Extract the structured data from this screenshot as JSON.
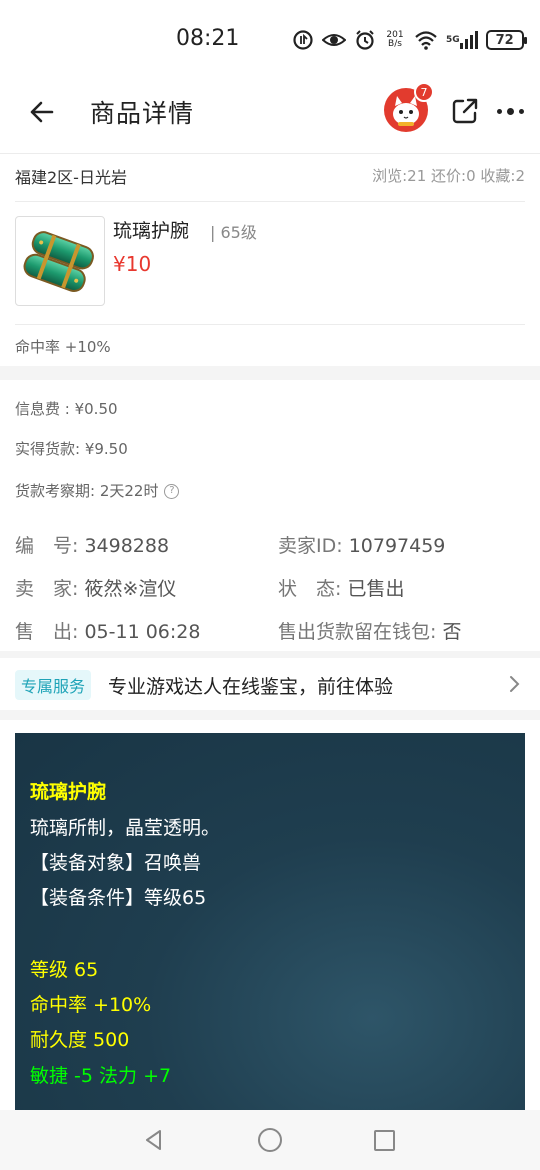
{
  "status_bar": {
    "time": "08:21",
    "net_speed_value": "201",
    "net_speed_unit": "B/s",
    "signal_label": "5G",
    "battery": "72",
    "icons": [
      "data-saver-icon",
      "eye-icon",
      "alarm-icon",
      "network-speed-icon",
      "wifi-icon",
      "signal-icon",
      "battery-icon"
    ]
  },
  "header": {
    "title": "商品详情",
    "avatar_badge": "7",
    "icons": [
      "back-arrow-icon",
      "avatar",
      "share-icon",
      "more-icon"
    ]
  },
  "listing": {
    "server": "福建2区-日光岩",
    "stats": "浏览:21 还价:0 收藏:2",
    "name": "琉璃护腕",
    "level": "| 65级",
    "price": "¥10",
    "attribute": "命中率 +10%"
  },
  "fees": {
    "info_fee": "信息费 : ¥0.50",
    "actual_payment": "实得货款:  ¥9.50",
    "inspection_period": "货款考察期:   2天22时"
  },
  "details": {
    "id_label": "编　号:",
    "id_value": "3498288",
    "seller_id_label": "卖家ID:",
    "seller_id_value": "10797459",
    "seller_label": "卖　家:",
    "seller_value": "筱然※渲仪",
    "status_label": "状　态:",
    "status_value": "已售出",
    "sold_label": "售　出:",
    "sold_value": "05-11 06:28",
    "wallet_label": "售出货款留在钱包:",
    "wallet_value": "否"
  },
  "service": {
    "tag": "专属服务",
    "text": "专业游戏达人在线鉴宝，前往体验"
  },
  "description": {
    "title": "琉璃护腕",
    "lines": [
      "琉璃所制，晶莹透明。",
      "【装备对象】召唤兽",
      "【装备条件】等级65"
    ],
    "stats": [
      "等级 65",
      "命中率 +10%",
      "耐久度 500"
    ],
    "bonus": "敏捷 -5 法力 +7"
  },
  "colors": {
    "price_red": "#e8382f",
    "service_teal": "#1fa3b7",
    "desc_bg": "#1f3e4f",
    "desc_yellow": "#ffff00",
    "desc_green": "#00ff00",
    "avatar_red": "#e23b2e"
  },
  "nav_bar": {
    "icons": [
      "nav-back-icon",
      "nav-home-icon",
      "nav-recent-icon"
    ]
  }
}
